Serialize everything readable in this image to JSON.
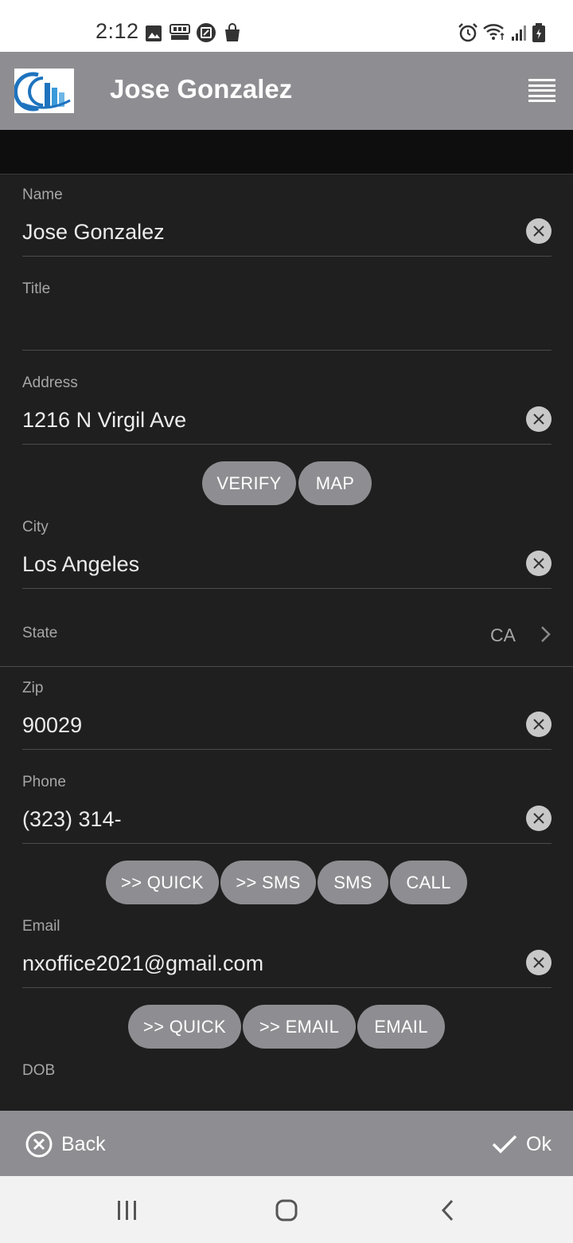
{
  "status_bar": {
    "time": "2:12",
    "left_icons": [
      "image-icon",
      "slots-blast-icon",
      "edit-square-icon",
      "shopping-bag-icon"
    ],
    "right_icons": [
      "alarm-icon",
      "wifi-icon",
      "signal-icon",
      "battery-charging-icon"
    ]
  },
  "header": {
    "title": "Jose Gonzalez",
    "logo": "building-logo",
    "menu_icon": "menu-icon"
  },
  "form": {
    "name": {
      "label": "Name",
      "value": "Jose Gonzalez"
    },
    "title": {
      "label": "Title",
      "value": ""
    },
    "address": {
      "label": "Address",
      "value": "1216 N Virgil Ave"
    },
    "address_actions": [
      "VERIFY",
      "MAP"
    ],
    "city": {
      "label": "City",
      "value": "Los Angeles"
    },
    "state": {
      "label": "State",
      "value": "CA"
    },
    "zip": {
      "label": "Zip",
      "value": "90029"
    },
    "phone": {
      "label": "Phone",
      "value": "(323) 314-"
    },
    "phone_actions": [
      ">> QUICK",
      ">> SMS",
      "SMS",
      "CALL"
    ],
    "email": {
      "label": "Email",
      "value": "nxoffice2021@gmail.com"
    },
    "email_actions": [
      ">> QUICK",
      ">> EMAIL",
      "EMAIL"
    ],
    "dob": {
      "label": "DOB"
    }
  },
  "footer": {
    "back_label": "Back",
    "ok_label": "Ok"
  },
  "colors": {
    "header_bg": "#8e8e92",
    "form_bg": "#1f1f1f",
    "pill_bg": "#8e8e92",
    "logo_blue": "#1e73be"
  }
}
